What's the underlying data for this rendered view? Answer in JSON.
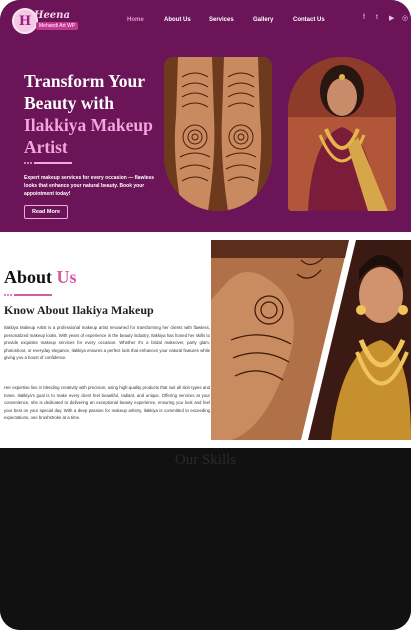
{
  "brand": {
    "logo_letter": "H",
    "logo_script": "Heena",
    "logo_tag": "Mehandi Art WP"
  },
  "nav": {
    "items": [
      "Home",
      "About Us",
      "Services",
      "Gallery",
      "Contact Us"
    ],
    "active": "Home"
  },
  "social": {
    "icons": [
      "facebook-icon",
      "twitter-icon",
      "youtube-icon",
      "instagram-icon"
    ],
    "glyphs": [
      "f",
      "t",
      "▶",
      "◎"
    ]
  },
  "hero": {
    "title_line1": "Transform Your",
    "title_line2": "Beauty with",
    "title_highlight1": "Ilakkiya Makeup",
    "title_highlight2": "Artist",
    "description": "Expert makeup services for every occasion — flawless looks that enhance your natural beauty. Book your appointment today!",
    "cta_label": "Read More"
  },
  "about": {
    "heading_plain": "About",
    "heading_highlight": "Us",
    "subheading": "Know About Ilakiya Makeup",
    "para1": "Ilakkiya Makeup Artist is a professional makeup artist renowned for transforming her clients with flawless, personalized makeup looks. With years of experience in the beauty industry, Ilakkiya has honed her skills to provide exquisite makeup services for every occasion. Whether it's a bridal makeover, party glam, photoshoot, or everyday elegance, Ilakkiya ensures a perfect look that enhances your natural features while giving you a boost of confidence.",
    "para2": "Her expertise lies in blending creativity with precision, using high-quality products that suit all skin types and tones. Ilakkiya's goal is to make every client feel beautiful, radiant, and unique. Offering services at your convenience, she is dedicated to delivering an exceptional beauty experience, ensuring you look and feel your best on your special day. With a deep passion for makeup artistry, Ilakkiya is committed to exceeding expectations, one brushstroke at a time."
  },
  "next_section": {
    "faded_heading": "Our Skills"
  },
  "colors": {
    "primary": "#6b1457",
    "accent": "#f2a6dc",
    "about_accent": "#d65aa8"
  }
}
